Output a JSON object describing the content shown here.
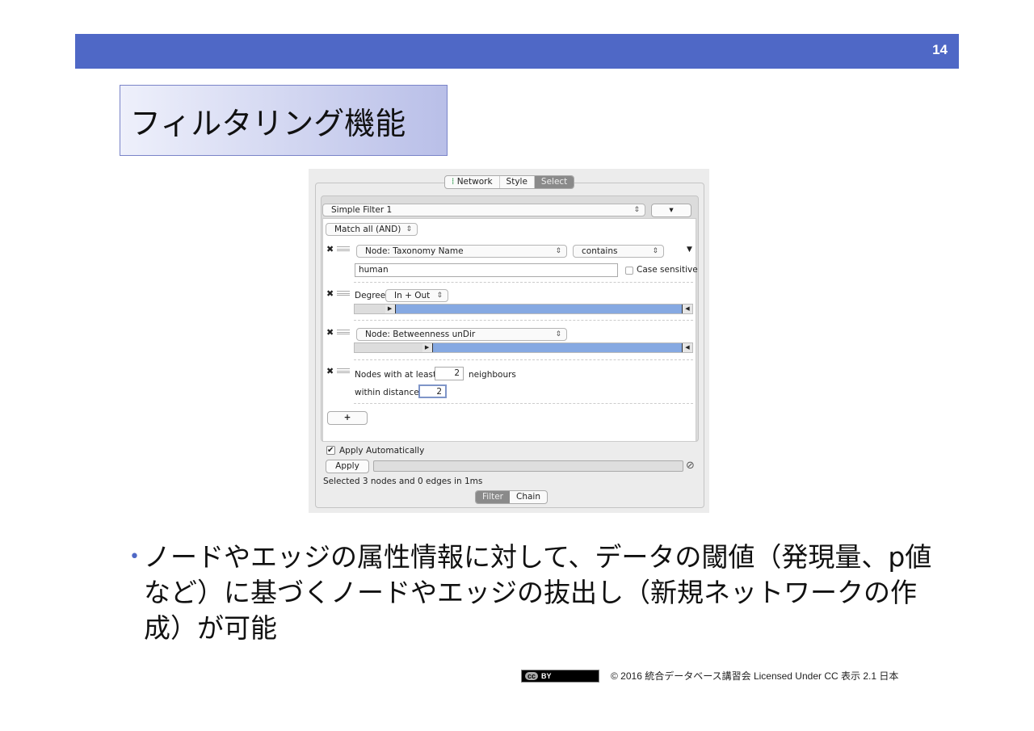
{
  "slide": {
    "page_number": "14",
    "title": "フィルタリング機能",
    "bullet": "ノードやエッジの属性情報に対して、データの閾値（発現量、p値など）に基づくノードやエッジの抜出し（新規ネットワークの作成）が可能",
    "footer": {
      "badge_cc": "cc",
      "badge_by": "BY",
      "text": "© 2016  統合データベース講習会 Licensed Under CC 表示 2.1 日本"
    }
  },
  "app": {
    "top_tabs": [
      {
        "label": "Network",
        "active": false
      },
      {
        "label": "Style",
        "active": false
      },
      {
        "label": "Select",
        "active": true
      }
    ],
    "filter_select": "Simple Filter 1",
    "options_button": "▾",
    "match_select": "Match all (AND)",
    "filters": {
      "taxonomy": {
        "column": "Node: Taxonomy Name",
        "operator": "contains",
        "value": "human",
        "case_sensitive_label": "Case sensitive",
        "case_sensitive": false
      },
      "degree": {
        "label": "Degree",
        "mode": "In + Out",
        "range_low_fraction": 0.09,
        "range_high_fraction": 1.0
      },
      "betweenness": {
        "column": "Node: Betweenness unDir",
        "range_low_fraction": 0.2,
        "range_high_fraction": 1.0
      },
      "neighbours": {
        "prefix": "Nodes with at least",
        "count": "2",
        "suffix": "neighbours",
        "distance_label": "within distance",
        "distance": "2"
      }
    },
    "add_button": "+",
    "apply_auto_label": "Apply Automatically",
    "apply_auto": true,
    "apply_button": "Apply",
    "status": "Selected 3 nodes and 0 edges in 1ms",
    "bottom_tabs": [
      {
        "label": "Filter",
        "active": true
      },
      {
        "label": "Chain",
        "active": false
      }
    ],
    "colors": {
      "band": "#4f68c6",
      "slider_fill": "#86a9e2"
    }
  }
}
